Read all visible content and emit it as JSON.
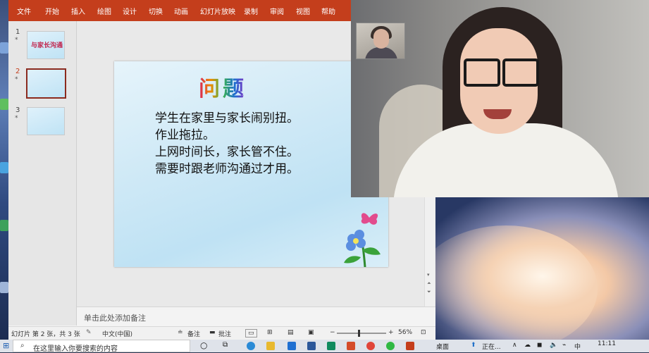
{
  "menu": {
    "items": [
      "文件",
      "开始",
      "插入",
      "绘图",
      "设计",
      "切换",
      "动画",
      "幻灯片放映",
      "录制",
      "审阅",
      "视图",
      "帮助"
    ]
  },
  "thumbnails": [
    {
      "num": "1",
      "star": "*",
      "text": "与家长沟通"
    },
    {
      "num": "2",
      "star": "*"
    },
    {
      "num": "3",
      "star": "*"
    }
  ],
  "slide": {
    "title": "问题",
    "lines": [
      "学生在家里与家长闹别扭。",
      "作业拖拉。",
      "上网时间长，家长管不住。",
      "需要时跟老师沟通过才用。"
    ]
  },
  "notes": {
    "placeholder": "单击此处添加备注"
  },
  "status": {
    "slide_info": "幻灯片 第 2 张，共 3 张",
    "language": "中文(中国)",
    "notes_label": "备注",
    "comments_label": "批注",
    "zoom": "56%"
  },
  "taskbar": {
    "search_placeholder": "在这里输入你要搜索的内容",
    "desktop_label": "桌面",
    "running_label": "正在...",
    "ime": "中",
    "time": "11:11"
  },
  "colors": {
    "ribbon": "#c43e1c",
    "selected_thumb": "#8b2a1e"
  }
}
